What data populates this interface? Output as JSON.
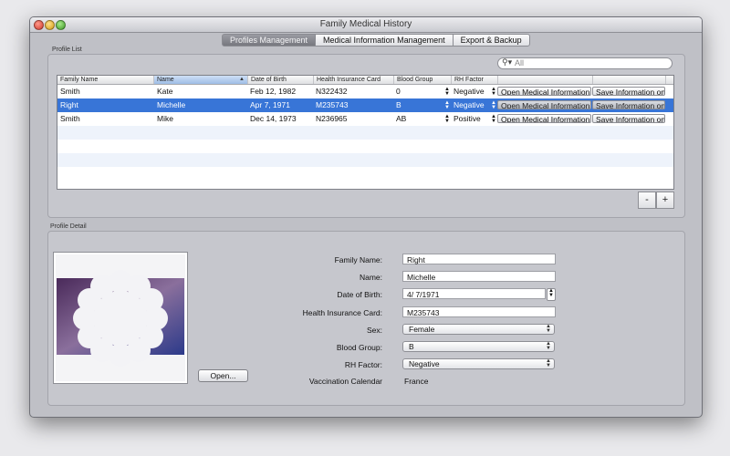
{
  "window": {
    "title": "Family Medical History"
  },
  "tabs": [
    {
      "label": "Profiles Management"
    },
    {
      "label": "Medical Information Management"
    },
    {
      "label": "Export & Backup"
    }
  ],
  "profile_list": {
    "group_label": "Profile List",
    "search": {
      "placeholder": "All"
    },
    "columns": [
      "Family Name",
      "Name",
      "Date of Birth",
      "Health Insurance Card",
      "Blood Group",
      "RH Factor",
      "",
      ""
    ],
    "rows": [
      {
        "family_name": "Smith",
        "name": "Kate",
        "dob": "Feb 12, 1982",
        "card": "N322432",
        "blood": "0",
        "rh": "Negative",
        "open": "Open Medical Information",
        "save": "Save Information on"
      },
      {
        "family_name": "Right",
        "name": "Michelle",
        "dob": "Apr 7, 1971",
        "card": "M235743",
        "blood": "B",
        "rh": "Negative",
        "open": "Open Medical Information",
        "save": "Save Information on"
      },
      {
        "family_name": "Smith",
        "name": "Mike",
        "dob": "Dec 14, 1973",
        "card": "N236965",
        "blood": "AB",
        "rh": "Positive",
        "open": "Open Medical Information",
        "save": "Save Information on"
      }
    ],
    "remove_label": "-",
    "add_label": "+"
  },
  "profile_detail": {
    "group_label": "Profile Detail",
    "open_button": "Open...",
    "labels": {
      "family_name": "Family Name:",
      "name": "Name:",
      "dob": "Date of Birth:",
      "card": "Health Insurance Card:",
      "sex": "Sex:",
      "blood": "Blood Group:",
      "rh": "RH Factor:",
      "vaccination": "Vaccination Calendar"
    },
    "values": {
      "family_name": "Right",
      "name": "Michelle",
      "dob": "4/  7/1971",
      "card": "M235743",
      "sex": "Female",
      "blood": "B",
      "rh": "Negative",
      "vaccination": "France"
    }
  },
  "colors": {
    "selection": "#3875d7",
    "window_bg": "#bfc0c6"
  }
}
